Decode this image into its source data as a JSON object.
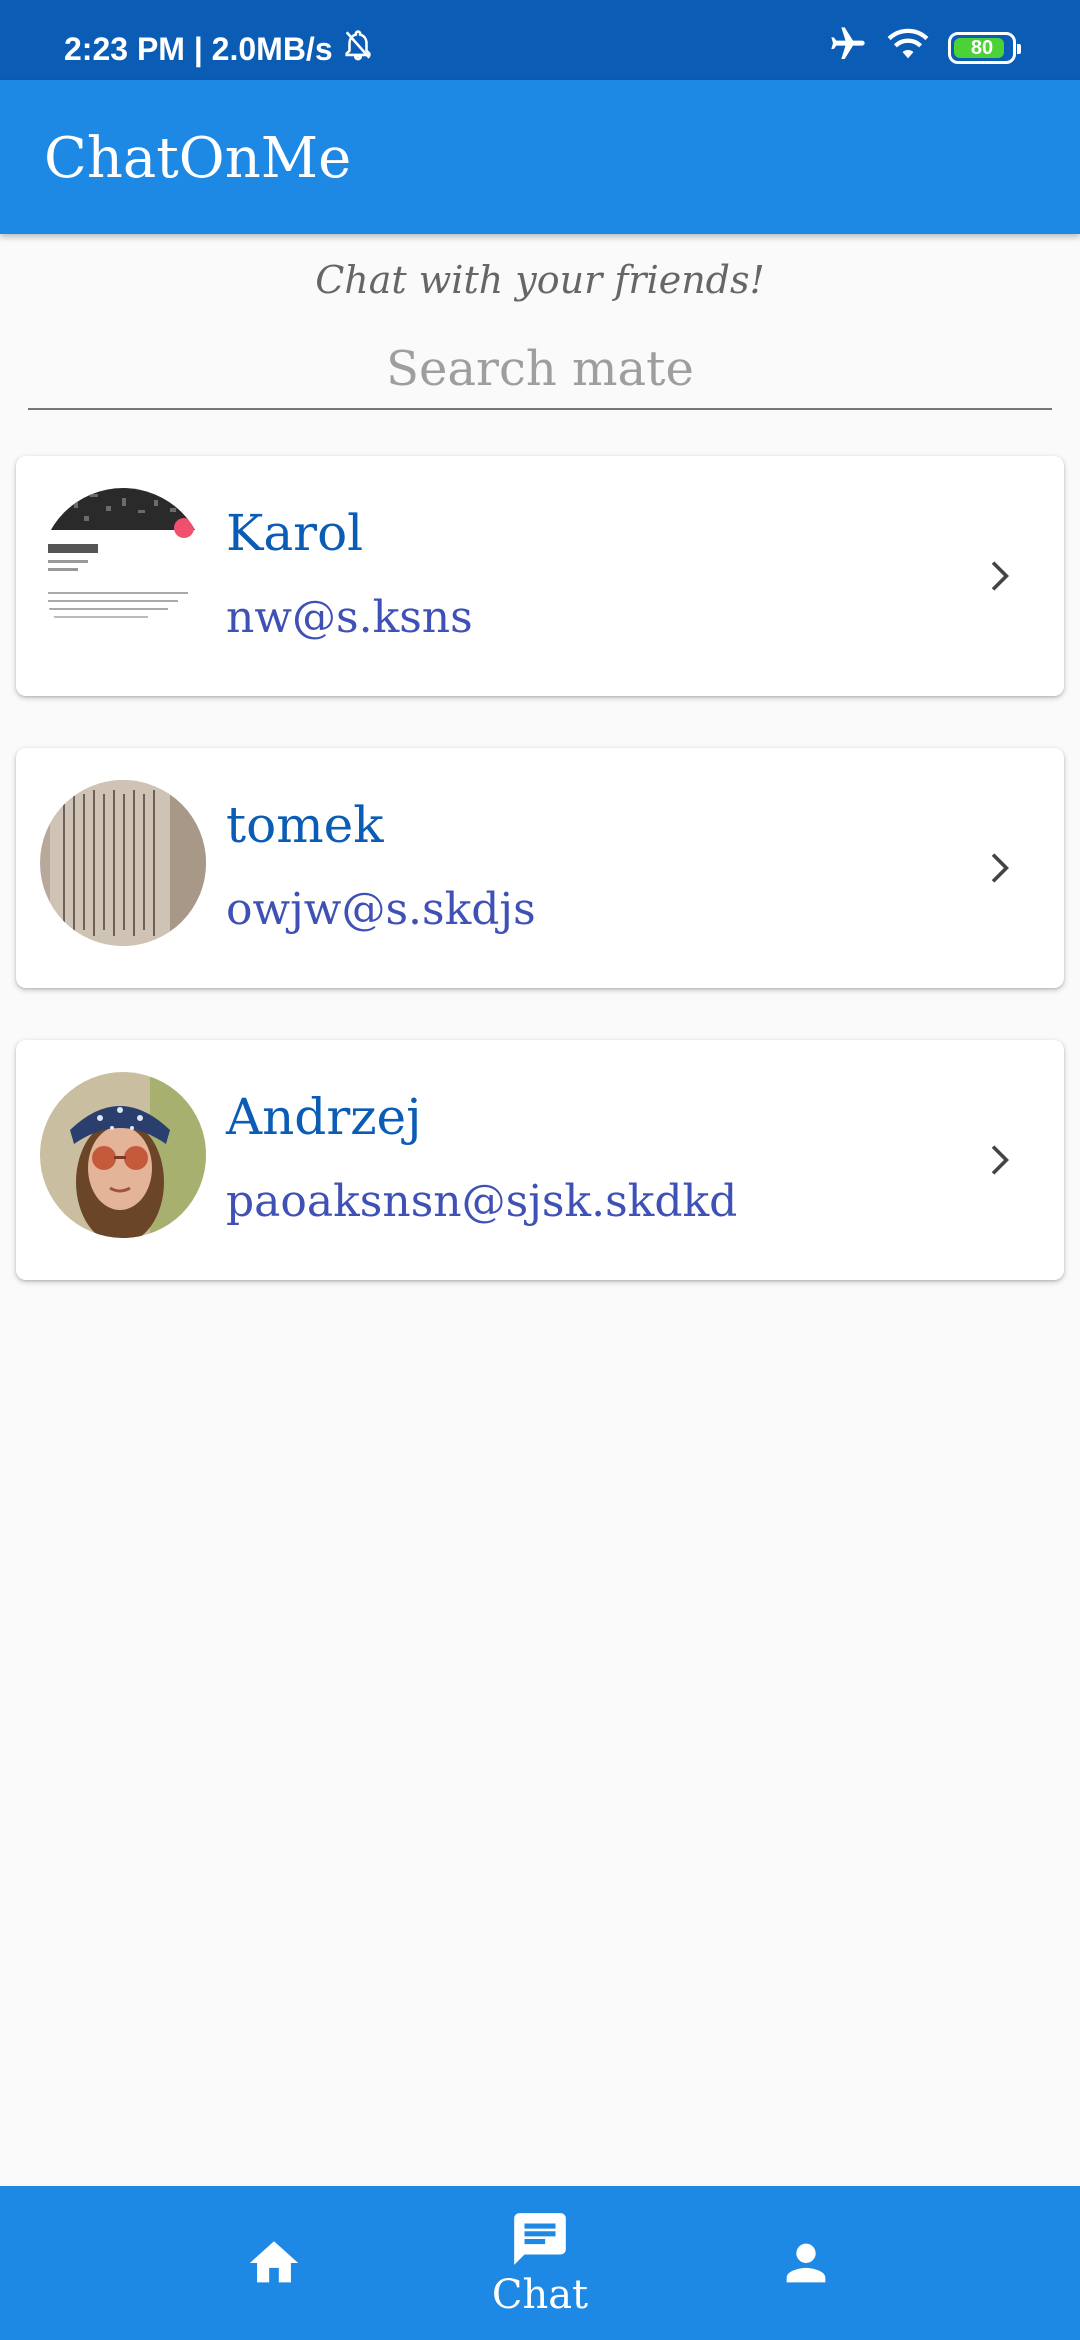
{
  "status_bar": {
    "time_speed": "2:23 PM | 2.0MB/s",
    "battery": "80",
    "icons": [
      "bell-off-icon",
      "airplane-icon",
      "wifi-icon",
      "battery-icon"
    ]
  },
  "app_bar": {
    "title": "ChatOnMe"
  },
  "main": {
    "subtitle": "Chat with your friends!",
    "search_placeholder": "Search mate"
  },
  "contacts": [
    {
      "name": "Karol",
      "email": "nw@s.ksns",
      "avatar": "screenshot-photo"
    },
    {
      "name": "tomek",
      "email": "owjw@s.skdjs",
      "avatar": "paper-photo"
    },
    {
      "name": "Andrzej",
      "email": "paoaksnsn@sjsk.skdkd",
      "avatar": "person-photo"
    }
  ],
  "bottom_nav": {
    "items": [
      {
        "icon": "home-icon",
        "label": ""
      },
      {
        "icon": "chat-icon",
        "label": "Chat"
      },
      {
        "icon": "person-icon",
        "label": ""
      }
    ]
  },
  "colors": {
    "status_bar": "#0a5cb5",
    "app_bar": "#1e88e5",
    "name_text": "#0a5cb5",
    "email_text": "#3f51b5",
    "battery_fill": "#4cd137"
  }
}
